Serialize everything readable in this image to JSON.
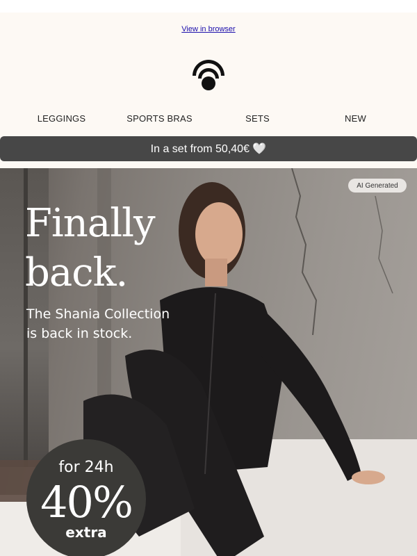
{
  "preheader": {
    "view_in_browser": "View in browser"
  },
  "logo": {
    "icon": "brand-logo-icon",
    "color": "#111111"
  },
  "nav": {
    "items": [
      {
        "label": "LEGGINGS"
      },
      {
        "label": "SPORTS BRAS"
      },
      {
        "label": "SETS"
      },
      {
        "label": "NEW"
      }
    ]
  },
  "promo_bar": {
    "text": "In a set from 50,40€ 🤍",
    "background": "#474747"
  },
  "hero": {
    "badge": "AI Generated",
    "headline_line1": "Finally",
    "headline_line2": "back.",
    "subline_line1": "The Shania Collection",
    "subline_line2": "is back in stock.",
    "image_description": "model-in-black-athleisure-set-sitting-icon"
  },
  "discount": {
    "line1": "for 24h",
    "line2": "40%",
    "line3": "extra",
    "background": "#3b3a37"
  }
}
